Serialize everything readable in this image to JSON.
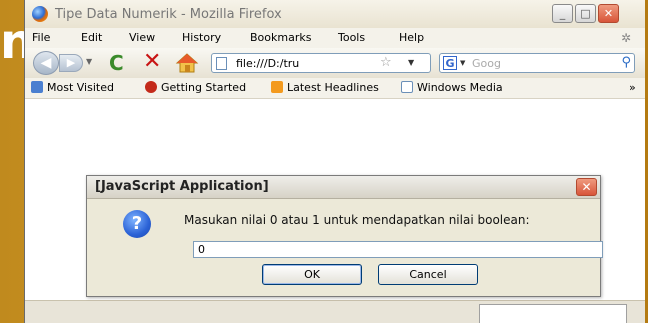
{
  "slide": {
    "glyph": "n"
  },
  "window": {
    "title": "Tipe Data Numerik - Mozilla Firefox",
    "controls": {
      "minimize": "_",
      "maximize": "□",
      "close": "✕"
    }
  },
  "menubar": {
    "items": [
      "File",
      "Edit",
      "View",
      "History",
      "Bookmarks",
      "Tools",
      "Help"
    ]
  },
  "toolbar": {
    "url": "file:///D:/tru",
    "search_placeholder": "Goog",
    "search_engine": "G"
  },
  "bookmarks": {
    "items": [
      "Most Visited",
      "Getting Started",
      "Latest Headlines",
      "Windows Media"
    ],
    "overflow": "»"
  },
  "dialog": {
    "title": "[JavaScript Application]",
    "message": "Masukan nilai 0 atau 1 untuk mendapatkan nilai boolean:",
    "input_value": "0",
    "ok_label": "OK",
    "cancel_label": "Cancel",
    "icon": "?"
  },
  "colors": {
    "slide_bg": "#c08a1e",
    "dialog_bg": "#ece9d8",
    "close_red": "#d8553a"
  }
}
